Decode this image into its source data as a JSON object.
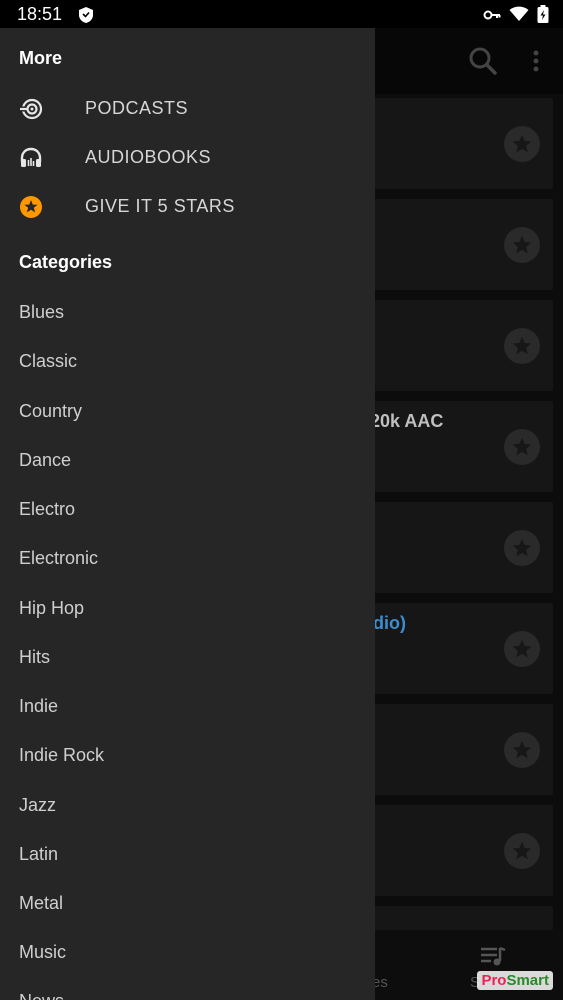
{
  "status_bar": {
    "time": "18:51"
  },
  "background_list": {
    "visible_texts": [
      "20k AAC",
      "dio)"
    ]
  },
  "bottom_nav": {
    "label_partial_1": "es",
    "label_partial_2": "S"
  },
  "drawer": {
    "more_title": "More",
    "more_items": [
      {
        "label": "PODCASTS",
        "icon": "podcast-icon"
      },
      {
        "label": "AUDIOBOOKS",
        "icon": "headphones-icon"
      },
      {
        "label": "GIVE IT 5 STARS",
        "icon": "star-badge-icon"
      }
    ],
    "categories_title": "Categories",
    "categories": [
      "Blues",
      "Classic",
      "Country",
      "Dance",
      "Electro",
      "Electronic",
      "Hip Hop",
      "Hits",
      "Indie",
      "Indie Rock",
      "Jazz",
      "Latin",
      "Metal",
      "Music",
      "News"
    ]
  },
  "watermark": {
    "part1": "Pro",
    "part2": "Smart"
  },
  "colors": {
    "drawer_bg": "#262626",
    "accent_star": "#ff9800",
    "link_blue": "#3c8dcf"
  }
}
